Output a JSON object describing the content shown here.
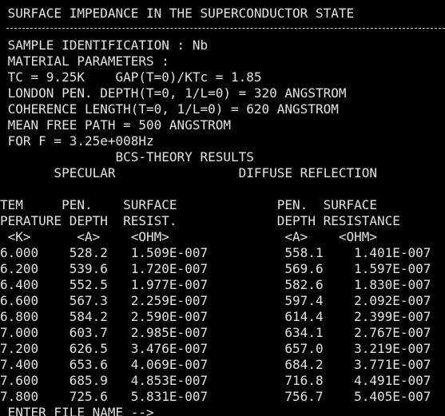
{
  "colors": {
    "background": "#000000",
    "text": "#e2e2e2"
  },
  "console": {
    "title": " SURFACE IMPEDANCE IN THE SUPERCONDUCTOR STATE",
    "sample_line": " SAMPLE IDENTIFICATION : Nb",
    "material_header": " MATERIAL PARAMETERS :",
    "tc_gap_line": " TC = 9.25K    GAP(T=0)/KTc = 1.85",
    "london_line": " LONDON PEN. DEPTH(T=0, 1/L=0) = 320 ANGSTROM",
    "coherence_line": " COHERENCE LENGTH(T=0, 1/L=0) = 620 ANGSTROM",
    "mfp_line": " MEAN FREE PATH = 500 ANGSTROM",
    "freq_line": " FOR F = 3.25e+008Hz",
    "results_title": "               BCS-THEORY RESULTS",
    "sections_line": "       SPECULAR                DIFFUSE REFLECTION",
    "header1": "TEM     PEN.    SURFACE             PEN.  SURFACE",
    "header2": "PERATURE DEPTH  RESIST.             DEPTH RESISTANCE",
    "units": " <K>      <A>    <OHM>               <A>    <OHM>",
    "rows": [
      "6.000    528.2   1.509E-007          558.1    1.401E-007",
      "6.200    539.6   1.720E-007          569.6    1.597E-007",
      "6.400    552.5   1.977E-007          582.6    1.830E-007",
      "6.600    567.3   2.259E-007          597.4    2.092E-007",
      "6.800    584.2   2.590E-007          614.4    2.399E-007",
      "7.000    603.7   2.985E-007          634.1    2.767E-007",
      "7.200    626.5   3.476E-007          657.0    3.219E-007",
      "7.400    653.6   4.069E-007          684.2    3.771E-007",
      "7.600    685.9   4.853E-007          716.8    4.491E-007",
      "7.800    725.6   5.831E-007          756.7    5.405E-007"
    ],
    "prompt": " ENTER FILE NAME -->"
  }
}
